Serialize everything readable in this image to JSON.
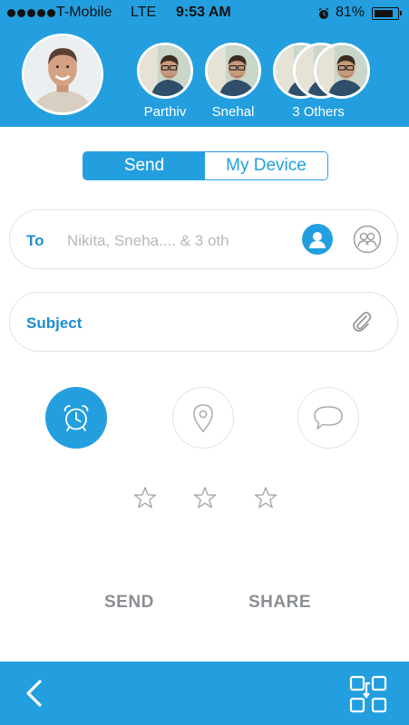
{
  "status_bar": {
    "carrier": "T-Mobile",
    "network": "LTE",
    "time": "9:53 AM",
    "battery": "81%",
    "battery_level": 0.81
  },
  "header": {
    "profile_avatar": "user-photo",
    "recipients": [
      {
        "label": "Parthiv",
        "avatar": "contact-photo"
      },
      {
        "label": "Snehal",
        "avatar": "contact-photo"
      },
      {
        "label": "3 Others",
        "avatar": "stacked-contact-photos"
      }
    ]
  },
  "segmented_control": {
    "options": [
      "Send",
      "My Device"
    ],
    "selected": "Send"
  },
  "form": {
    "to_label": "To",
    "to_value": "Nikita, Sneha.... & 3 oth",
    "subject_label": "Subject",
    "icons": [
      "person-icon",
      "group-icon",
      "paperclip-icon"
    ]
  },
  "options": {
    "icons": [
      "alarm-clock-icon",
      "location-pin-icon",
      "chat-bubble-icon"
    ],
    "active": "alarm-clock-icon",
    "rating_stars": 3,
    "rating_value": 0
  },
  "actions": {
    "send": "SEND",
    "share": "SHARE"
  },
  "footer": {
    "icons": [
      "back-chevron-icon",
      "swap-icon"
    ]
  },
  "colors": {
    "primary": "#239fdf",
    "label_blue": "#1d8ed0",
    "muted_text": "#b5b9bd",
    "action_gray": "#8b8f93",
    "border": "#dfe3e6"
  }
}
